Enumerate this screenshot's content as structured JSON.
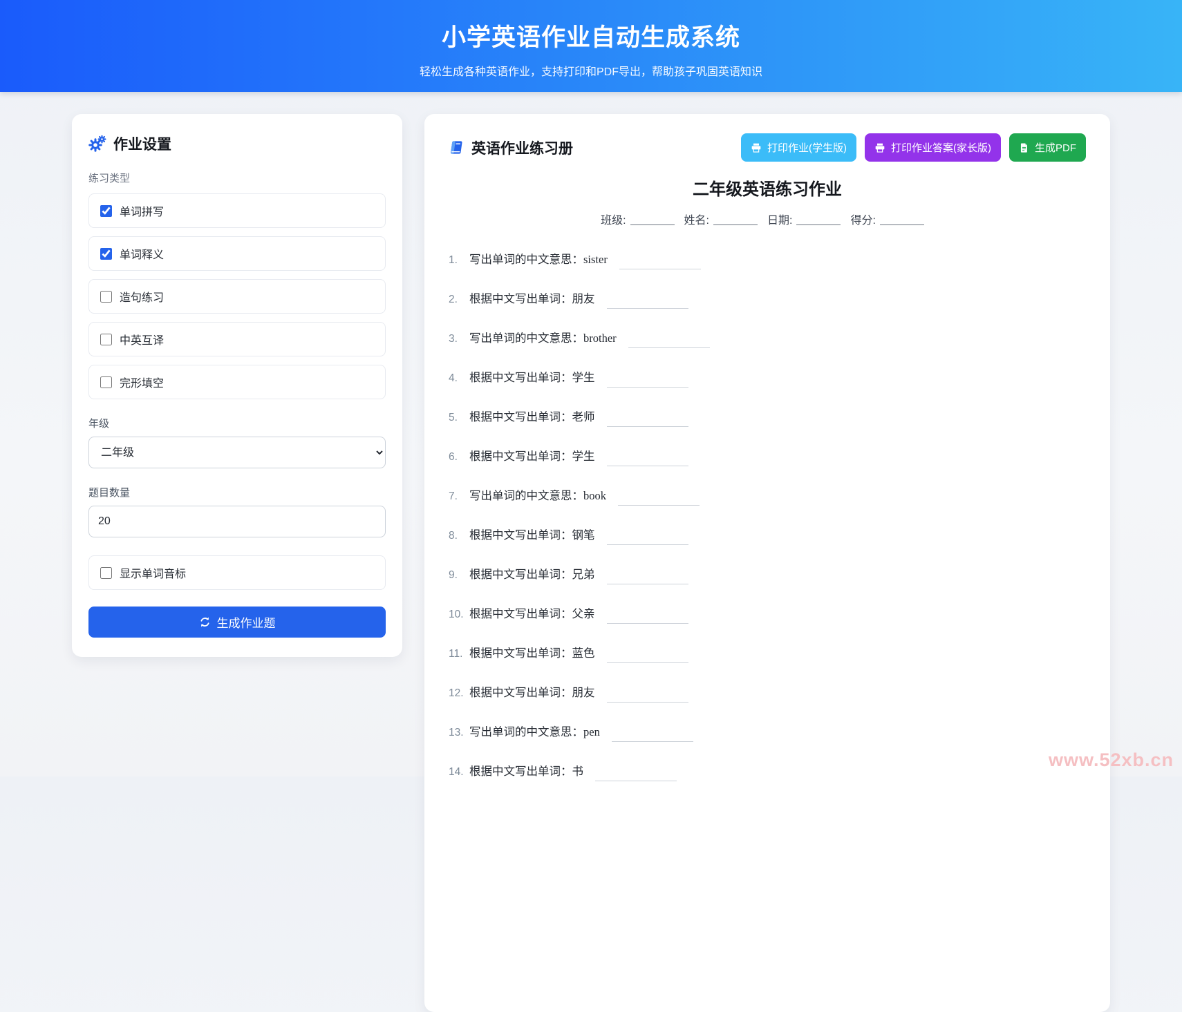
{
  "header": {
    "title": "小学英语作业自动生成系统",
    "subtitle": "轻松生成各种英语作业，支持打印和PDF导出，帮助孩子巩固英语知识"
  },
  "settings": {
    "panel_title": "作业设置",
    "panel_icon": "gears-icon",
    "exercise_type_label": "练习类型",
    "exercise_types": [
      {
        "label": "单词拼写",
        "checked": true
      },
      {
        "label": "单词释义",
        "checked": true
      },
      {
        "label": "造句练习",
        "checked": false
      },
      {
        "label": "中英互译",
        "checked": false
      },
      {
        "label": "完形填空",
        "checked": false
      }
    ],
    "grade_label": "年级",
    "grade_selected": "二年级",
    "question_count_label": "题目数量",
    "question_count_value": "20",
    "phonetic_checkbox": {
      "label": "显示单词音标",
      "checked": false
    },
    "generate_button_label": "生成作业题",
    "generate_button_icon": "refresh-icon"
  },
  "worksheet": {
    "panel_title": "英语作业练习册",
    "panel_icon": "book-icon",
    "buttons": [
      {
        "label": "打印作业(学生版)",
        "icon": "printer-icon",
        "color": "#3bbcf8"
      },
      {
        "label": "打印作业答案(家长版)",
        "icon": "printer-icon",
        "color": "#9333ea"
      },
      {
        "label": "生成PDF",
        "icon": "pdf-file-icon",
        "color": "#1fa850"
      }
    ],
    "title": "二年级英语练习作业",
    "info_fields": [
      "班级:",
      "姓名:",
      "日期:",
      "得分:"
    ],
    "questions": [
      {
        "num": "1.",
        "prompt": "写出单词的中文意思：",
        "word": "sister",
        "word_lang": "en"
      },
      {
        "num": "2.",
        "prompt": "根据中文写出单词：",
        "word": "朋友",
        "word_lang": "zh"
      },
      {
        "num": "3.",
        "prompt": "写出单词的中文意思：",
        "word": "brother",
        "word_lang": "en"
      },
      {
        "num": "4.",
        "prompt": "根据中文写出单词：",
        "word": "学生",
        "word_lang": "zh"
      },
      {
        "num": "5.",
        "prompt": "根据中文写出单词：",
        "word": "老师",
        "word_lang": "zh"
      },
      {
        "num": "6.",
        "prompt": "根据中文写出单词：",
        "word": "学生",
        "word_lang": "zh"
      },
      {
        "num": "7.",
        "prompt": "写出单词的中文意思：",
        "word": "book",
        "word_lang": "en"
      },
      {
        "num": "8.",
        "prompt": "根据中文写出单词：",
        "word": "钢笔",
        "word_lang": "zh"
      },
      {
        "num": "9.",
        "prompt": "根据中文写出单词：",
        "word": "兄弟",
        "word_lang": "zh"
      },
      {
        "num": "10.",
        "prompt": "根据中文写出单词：",
        "word": "父亲",
        "word_lang": "zh"
      },
      {
        "num": "11.",
        "prompt": "根据中文写出单词：",
        "word": "蓝色",
        "word_lang": "zh"
      },
      {
        "num": "12.",
        "prompt": "根据中文写出单词：",
        "word": "朋友",
        "word_lang": "zh"
      },
      {
        "num": "13.",
        "prompt": "写出单词的中文意思：",
        "word": "pen",
        "word_lang": "en"
      },
      {
        "num": "14.",
        "prompt": "根据中文写出单词：",
        "word": "书",
        "word_lang": "zh"
      }
    ]
  },
  "watermark": "www.52xb.cn",
  "colors": {
    "header_gradient_start": "#1a5bfb",
    "header_gradient_end": "#38b4f7",
    "accent": "#2563eb",
    "print_student_button": "#3bbcf8",
    "print_answer_button": "#9333ea",
    "pdf_button": "#1fa850",
    "watermark": "#f5bfc2"
  }
}
